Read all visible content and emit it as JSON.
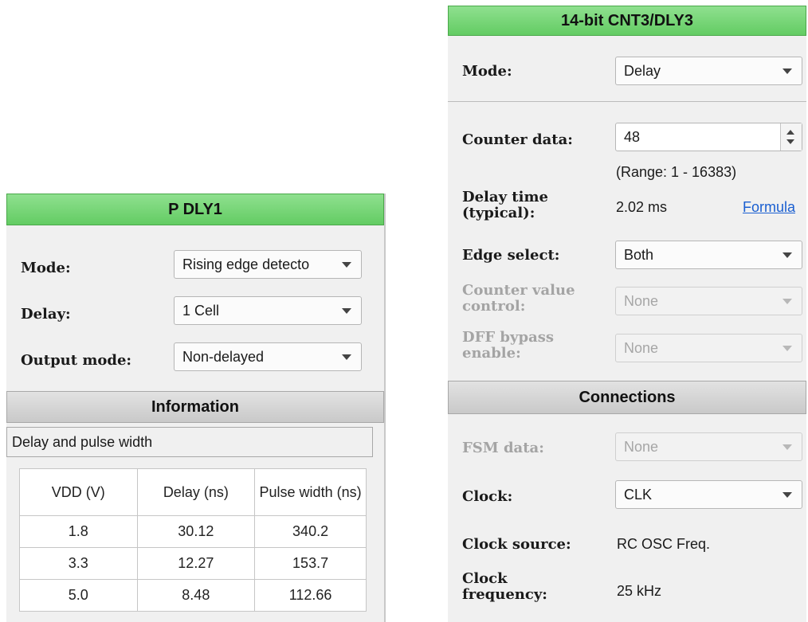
{
  "left_panel": {
    "title": "P DLY1",
    "fields": {
      "mode": {
        "label": "Mode:",
        "value": "Rising edge detecto"
      },
      "delay": {
        "label": "Delay:",
        "value": "1 Cell"
      },
      "output_mode": {
        "label": "Output mode:",
        "value": "Non-delayed"
      }
    },
    "info_header": "Information",
    "info_subtitle": "Delay and pulse width",
    "table": {
      "headers": [
        "VDD (V)",
        "Delay (ns)",
        "Pulse width (ns)"
      ],
      "rows": [
        [
          "1.8",
          "30.12",
          "340.2"
        ],
        [
          "3.3",
          "12.27",
          "153.7"
        ],
        [
          "5.0",
          "8.48",
          "112.66"
        ]
      ]
    }
  },
  "right_panel": {
    "title": "14-bit CNT3/DLY3",
    "mode": {
      "label": "Mode:",
      "value": "Delay"
    },
    "counter_data": {
      "label": "Counter data:",
      "value": "48",
      "range": "(Range:  1 - 16383)"
    },
    "delay_time": {
      "label_line1": "Delay time",
      "label_line2": "(typical):",
      "value": "2.02 ms",
      "link": "Formula"
    },
    "edge_select": {
      "label": "Edge select:",
      "value": "Both"
    },
    "counter_value_control": {
      "label_line1": "Counter value",
      "label_line2": "control:",
      "value": "None"
    },
    "dff_bypass": {
      "label_line1": "DFF bypass",
      "label_line2": "enable:",
      "value": "None"
    },
    "connections_header": "Connections",
    "fsm_data": {
      "label": "FSM data:",
      "value": "None"
    },
    "clock": {
      "label": "Clock:",
      "value": "CLK"
    },
    "clock_source": {
      "label": "Clock source:",
      "value": "RC OSC Freq."
    },
    "clock_frequency": {
      "label_line1": "Clock",
      "label_line2": "frequency:",
      "value": "25 kHz"
    }
  },
  "colors": {
    "header_green": "#63cc63",
    "header_gray": "#c9c9c9",
    "panel_bg": "#f0f0f0",
    "disabled_text": "#a4a4a4",
    "link": "#1a5fd1"
  }
}
